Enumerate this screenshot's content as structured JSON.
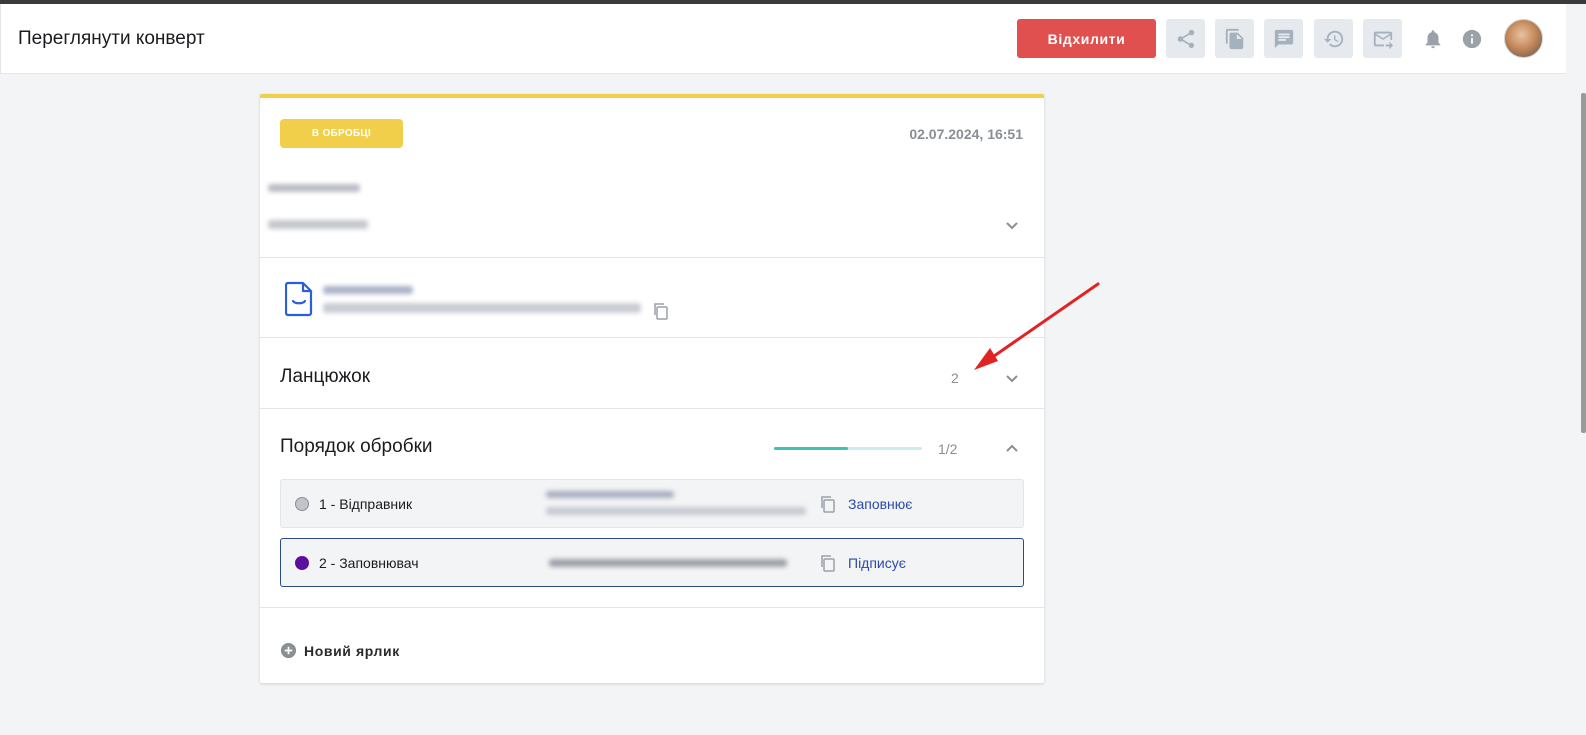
{
  "header": {
    "title": "Переглянути конверт",
    "reject_label": "Відхилити",
    "icons": [
      "share-icon",
      "copy-document-icon",
      "comment-icon",
      "history-icon",
      "forward-mail-icon",
      "bell-icon",
      "info-icon"
    ]
  },
  "envelope": {
    "status": "В ОБРОБЦІ",
    "date": "02.07.2024, 16:51"
  },
  "chain": {
    "title": "Ланцюжок",
    "count": "2"
  },
  "processing": {
    "title": "Порядок обробки",
    "progress_text": "1/2",
    "progress_fraction": 0.5,
    "steps": [
      {
        "label": "1 - Відправник",
        "action": "Заповнює",
        "dot_color": "#c2c4c9"
      },
      {
        "label": "2 - Заповнювач",
        "action": "Підписує",
        "dot_color": "#5c0f9c"
      }
    ]
  },
  "new_label": "Новий ярлик",
  "colors": {
    "accent_yellow": "#f2cf4a",
    "reject_red": "#e0504f",
    "progress_teal": "#3cc2b2",
    "link_blue": "#2d4aa8",
    "annotation_arrow": "#e02424"
  }
}
